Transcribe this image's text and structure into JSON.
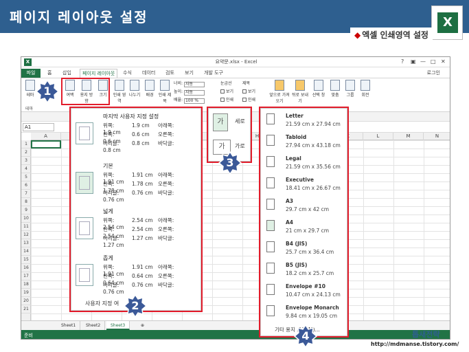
{
  "header": {
    "title": "페이지 레이아웃 설정",
    "subtitle": "엑셀 인쇄영역 설정",
    "logo": "X"
  },
  "excel": {
    "title": "요약문.xlsx - Excel",
    "window_controls": [
      "?",
      "▣",
      "—",
      "□",
      "✕"
    ],
    "tabs": [
      "파일",
      "홈",
      "삽입",
      "페이지 레이아웃",
      "수식",
      "데이터",
      "검토",
      "보기",
      "개발 도구"
    ],
    "login": "로그인",
    "ribbon": {
      "theme": "테마",
      "themes_group": "테마",
      "margins": "여백",
      "orientation": "용지 방향",
      "size": "크기",
      "print_area": "인쇄 영역",
      "breaks": "나누기",
      "background": "배경",
      "print_titles": "인쇄 제목",
      "width_label": "너비:",
      "width_value": "자동",
      "height_label": "높이:",
      "height_value": "자동",
      "scale_label": "배율:",
      "scale_value": "100 %",
      "gridlines": "눈금선",
      "headings": "제목",
      "view": "보기",
      "print": "인쇄",
      "bring_forward": "앞으로 가져오기",
      "send_backward": "뒤로 보내기",
      "selection_pane": "선택 창",
      "align": "맞춤",
      "group": "그룹",
      "rotate": "회전"
    },
    "name_box": "A1",
    "formula_font": "맑은",
    "columns": [
      "A",
      "B",
      "C",
      "D",
      "E",
      "F",
      "G",
      "H",
      "I",
      "J",
      "K",
      "L",
      "M",
      "N"
    ],
    "rows": [
      "1",
      "2",
      "3",
      "4",
      "5",
      "6",
      "7",
      "8",
      "9",
      "10",
      "11",
      "12",
      "13",
      "14",
      "15",
      "16",
      "17",
      "18",
      "19",
      "20",
      "21"
    ],
    "sheets": [
      "Sheet1",
      "Sheet2",
      "Sheet3"
    ],
    "add_sheet": "⊕",
    "status": "준비"
  },
  "margins_menu": {
    "options": [
      {
        "name": "마지막 사용자 지정 설정",
        "top_label": "위쪽:",
        "top": "1.9 cm",
        "bottom_label": "아래쪽:",
        "bottom": "1.9 cm",
        "left_label": "왼쪽:",
        "left": "0.6 cm",
        "right_label": "오른쪽:",
        "right": "0.6 cm",
        "header_label": "머리글:",
        "header": "0.8 cm",
        "footer_label": "바닥글:",
        "footer": "0.8 cm"
      },
      {
        "name": "기본",
        "top_label": "위쪽:",
        "top": "1.91 cm",
        "bottom_label": "아래쪽:",
        "bottom": "1.91 cm",
        "left_label": "왼쪽:",
        "left": "1.78 cm",
        "right_label": "오른쪽:",
        "right": "1.78 cm",
        "header_label": "머리글:",
        "header": "0.76 cm",
        "footer_label": "바닥글:",
        "footer": "0.76 cm"
      },
      {
        "name": "넓게",
        "top_label": "위쪽:",
        "top": "2.54 cm",
        "bottom_label": "아래쪽:",
        "bottom": "2.54 cm",
        "left_label": "왼쪽:",
        "left": "2.54 cm",
        "right_label": "오른쪽:",
        "right": "2.54 cm",
        "header_label": "머리글:",
        "header": "1.27 cm",
        "footer_label": "바닥글:",
        "footer": "1.27 cm"
      },
      {
        "name": "좁게",
        "top_label": "위쪽:",
        "top": "1.91 cm",
        "bottom_label": "아래쪽:",
        "bottom": "1.91 cm",
        "left_label": "왼쪽:",
        "left": "0.64 cm",
        "right_label": "오른쪽:",
        "right": "0.64 cm",
        "header_label": "머리글:",
        "header": "0.76 cm",
        "footer_label": "바닥글:",
        "footer": "0.76 cm"
      }
    ],
    "custom": "사용자 지정 여"
  },
  "orientation_menu": {
    "portrait": "세로",
    "landscape": "가로",
    "portrait_icon": "가",
    "landscape_icon": "가"
  },
  "size_menu": {
    "options": [
      {
        "name": "Letter",
        "dim": "21.59 cm x 27.94 cm"
      },
      {
        "name": "Tabloid",
        "dim": "27.94 cm x 43.18 cm"
      },
      {
        "name": "Legal",
        "dim": "21.59 cm x 35.56 cm"
      },
      {
        "name": "Executive",
        "dim": "18.41 cm x 26.67 cm"
      },
      {
        "name": "A3",
        "dim": "29.7 cm x 42 cm"
      },
      {
        "name": "A4",
        "dim": "21 cm x 29.7 cm"
      },
      {
        "name": "B4 (JIS)",
        "dim": "25.7 cm x 36.4 cm"
      },
      {
        "name": "B5 (JIS)",
        "dim": "18.2 cm x 25.7 cm"
      },
      {
        "name": "Envelope #10",
        "dim": "10.47 cm x 24.13 cm"
      },
      {
        "name": "Envelope Monarch",
        "dim": "9.84 cm x 19.05 cm"
      }
    ],
    "more": "기타 용지 크기(M)..."
  },
  "badges": [
    "1",
    "2",
    "3",
    "4"
  ],
  "footer": {
    "url": "http://mdmanse.tistory.com/",
    "brand": "톱새전략"
  },
  "colors": {
    "header_bg": "#2e5f8f",
    "excel_green": "#217346",
    "callout_red": "#e21c2b",
    "badge": "#3b5998"
  }
}
